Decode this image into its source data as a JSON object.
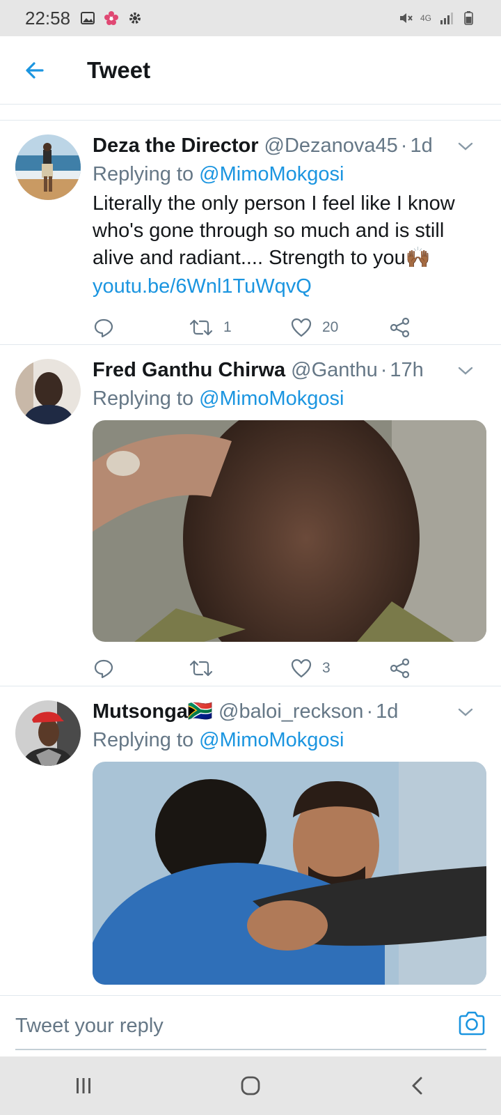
{
  "status_bar": {
    "time": "22:58",
    "network": "4G"
  },
  "header": {
    "title": "Tweet"
  },
  "tweets": [
    {
      "name": "Deza the Director",
      "handle": "@Dezanova45",
      "time": "1d",
      "replying_prefix": "Replying to ",
      "replying_to": "@MimoMokgosi",
      "text": "Literally the only person I feel like I know who's gone through so much and is still alive and radiant.... Strength to you🙌🏾",
      "link": "youtu.be/6Wnl1TuWqvQ",
      "retweets": "1",
      "likes": "20"
    },
    {
      "name": "Fred Ganthu Chirwa",
      "handle": "@Ganthu",
      "time": "17h",
      "replying_prefix": "Replying to ",
      "replying_to": "@MimoMokgosi",
      "retweets": "",
      "likes": "3"
    },
    {
      "name": "Mutsonga🇿🇦",
      "handle": "@baloi_reckson",
      "time": "1d",
      "replying_prefix": "Replying to ",
      "replying_to": "@MimoMokgosi"
    }
  ],
  "reply_bar": {
    "placeholder": "Tweet your reply"
  },
  "colors": {
    "accent": "#1b95e0",
    "secondary_text": "#657786",
    "divider": "#e1e8ed"
  },
  "icons": {
    "back": "arrow-left-icon",
    "caret": "chevron-down-icon",
    "reply": "speech-bubble-icon",
    "retweet": "retweet-icon",
    "like": "heart-icon",
    "share": "share-icon",
    "camera": "camera-icon"
  }
}
